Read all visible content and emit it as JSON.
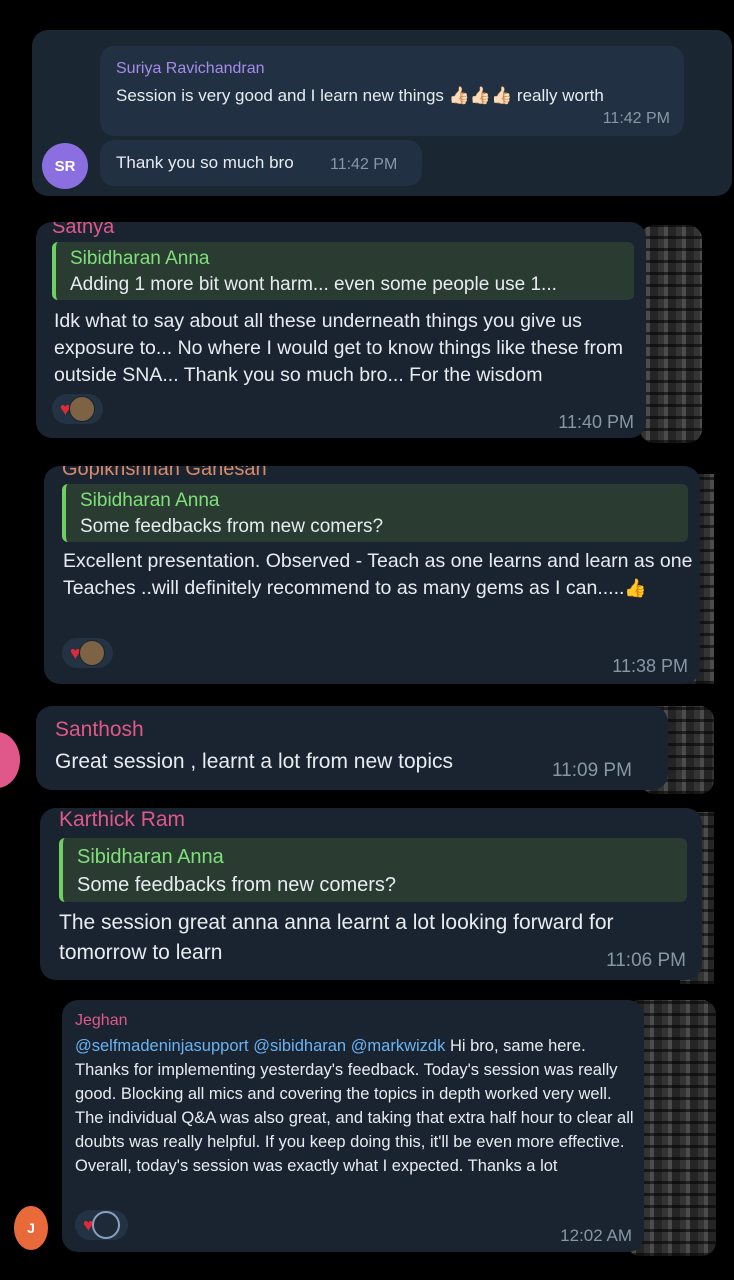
{
  "messages": [
    {
      "nested_sender": "Suriya Ravichandran",
      "nested_text": "Session is very good and I learn new things",
      "nested_emojis": "👍🏻👍🏻👍🏻",
      "nested_tail": "really worth",
      "nested_time": "11:42 PM",
      "avatar_initials": "SR",
      "text": "Thank you so much bro",
      "time": "11:42 PM"
    },
    {
      "sender": "Sathya",
      "reply_name": "Sibidharan Anna",
      "reply_text": "Adding 1 more bit wont harm... even some people use 1...",
      "text": "Idk what to say about all these underneath things you give us exposure to... No where I would get to know things like these from outside SNA... Thank you so much bro... For the wisdom",
      "time": "11:40 PM"
    },
    {
      "sender": "Gopikrishnan Ganesan",
      "reply_name": "Sibidharan Anna",
      "reply_text": "Some feedbacks from new comers?",
      "text": "Excellent presentation. Observed - Teach as one learns and learn as one Teaches ..will definitely recommend to as many gems as I can.....",
      "emoji": "👍",
      "time": "11:38 PM"
    },
    {
      "sender": "Santhosh",
      "text": "Great session , learnt a lot from new topics",
      "time": "11:09 PM"
    },
    {
      "sender": "Karthick Ram",
      "reply_name": "Sibidharan Anna",
      "reply_text": "Some feedbacks from new comers?",
      "text": "The session great anna anna learnt a lot looking forward for tomorrow to learn",
      "time": "11:06 PM"
    },
    {
      "sender": "Jeghan",
      "avatar_initials": "J",
      "mentions": [
        "@selfmadeninjasupport",
        "@sibidharan",
        "@markwizdk"
      ],
      "text": "Hi bro, same here. Thanks for implementing yesterday's feedback. Today's session was really good. Blocking all mics and covering the topics in depth worked very well. The individual Q&A was also great, and taking that extra half hour to clear all doubts was really helpful. If you keep doing this, it'll be even more effective. Overall, today's session was exactly what I expected. Thanks a lot",
      "time": "12:02 AM"
    }
  ],
  "colors": {
    "background": "#000000",
    "bubble": "#1a2430",
    "reply_bg": "#2a3b32",
    "reply_name": "#7fe07a",
    "sender_pink": "#e0588a",
    "sender_purple": "#a58de8",
    "mention_blue": "#6ab2f2",
    "time": "#8797a6"
  }
}
